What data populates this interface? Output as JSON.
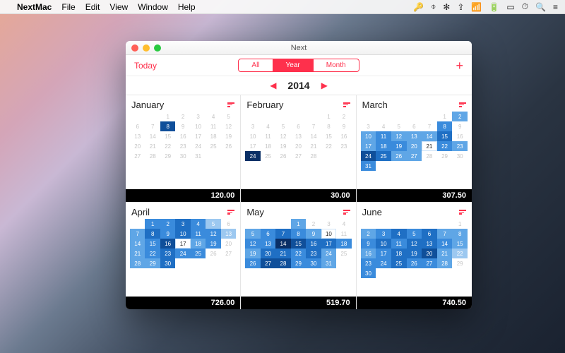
{
  "menubar": {
    "apple": "",
    "app": "NextMac",
    "items": [
      "File",
      "Edit",
      "View",
      "Window",
      "Help"
    ],
    "status": [
      "🔑",
      "⌽",
      "✻",
      "⇪",
      "📶",
      "🔋",
      "▭",
      "⏱",
      "🔍",
      "≡"
    ]
  },
  "window": {
    "title": "Next",
    "today": "Today",
    "add": "+",
    "segments": {
      "all": "All",
      "year": "Year",
      "month": "Month",
      "active": "year"
    },
    "nav": {
      "prev": "◀",
      "next": "▶",
      "year": "2014"
    }
  },
  "months": [
    {
      "name": "January",
      "total": "120.00",
      "start": 2,
      "ndays": 31,
      "hi": {
        "8": "l5"
      }
    },
    {
      "name": "February",
      "total": "30.00",
      "start": 5,
      "ndays": 28,
      "hi": {
        "24": "l6"
      }
    },
    {
      "name": "March",
      "total": "307.50",
      "start": 5,
      "ndays": 31,
      "hi": {
        "2": "l2",
        "8": "l3",
        "10": "l2",
        "11": "l3",
        "12": "l2",
        "13": "l2",
        "14": "l2",
        "15": "l4",
        "17": "l2",
        "18": "l3",
        "19": "l3",
        "20": "l2",
        "21": "lw",
        "22": "l3",
        "23": "l2",
        "24": "l5",
        "25": "l4",
        "26": "l2",
        "27": "l2",
        "31": "l3"
      }
    },
    {
      "name": "April",
      "total": "726.00",
      "start": 1,
      "ndays": 30,
      "hi": {
        "1": "l3",
        "2": "l3",
        "3": "l4",
        "4": "l3",
        "5": "l1",
        "7": "l2",
        "8": "l4",
        "9": "l3",
        "10": "l4",
        "11": "l3",
        "12": "l3",
        "13": "l1",
        "14": "l2",
        "15": "l3",
        "16": "l5",
        "17": "lw",
        "18": "l2",
        "19": "l3",
        "21": "l2",
        "22": "l3",
        "23": "l4",
        "24": "l3",
        "25": "l3",
        "28": "l2",
        "29": "l2",
        "30": "l4"
      }
    },
    {
      "name": "May",
      "total": "519.70",
      "start": 3,
      "ndays": 31,
      "hi": {
        "1": "l2",
        "5": "l2",
        "6": "l3",
        "7": "l4",
        "8": "l3",
        "9": "l2",
        "10": "lw",
        "12": "l3",
        "13": "l3",
        "14": "l6",
        "15": "l5",
        "16": "l4",
        "17": "l4",
        "18": "l3",
        "19": "l2",
        "20": "l4",
        "21": "l4",
        "22": "l3",
        "23": "l4",
        "24": "l2",
        "26": "l3",
        "27": "l5",
        "28": "l5",
        "29": "l3",
        "30": "l3",
        "31": "l2"
      }
    },
    {
      "name": "June",
      "total": "740.50",
      "start": 6,
      "ndays": 30,
      "hi": {
        "2": "l2",
        "3": "l3",
        "4": "l4",
        "5": "l3",
        "6": "l4",
        "7": "l2",
        "8": "l2",
        "9": "l3",
        "10": "l4",
        "11": "l3",
        "12": "l4",
        "13": "l4",
        "14": "l3",
        "15": "l2",
        "16": "l2",
        "17": "l3",
        "18": "l4",
        "19": "l4",
        "20": "l5",
        "21": "l2",
        "22": "l1",
        "23": "l3",
        "24": "l3",
        "25": "l4",
        "26": "l3",
        "27": "l3",
        "28": "l2",
        "30": "l3"
      }
    }
  ]
}
